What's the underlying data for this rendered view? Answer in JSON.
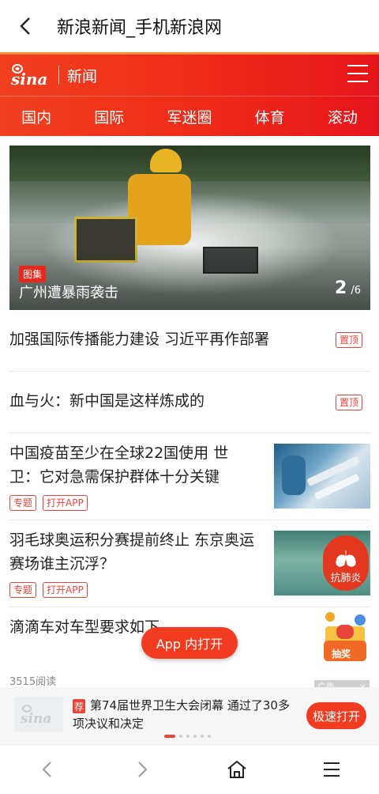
{
  "titlebar": {
    "title": "新浪新闻_手机新浪网"
  },
  "header": {
    "logo_text": "sina",
    "channel": "新闻",
    "nav": [
      "国内",
      "国际",
      "军迷圈",
      "体育",
      "滚动"
    ]
  },
  "hero": {
    "tag": "图集",
    "caption": "广州遭暴雨袭击",
    "current": "2",
    "total": "/6"
  },
  "news": [
    {
      "headline": "加强国际传播能力建设 习近平再作部署",
      "pin": "置顶"
    },
    {
      "headline": "血与火：新中国是这样炼成的",
      "pin": "置顶"
    },
    {
      "headline": "中国疫苗至少在全球22国使用 世卫：它对急需保护群体十分关键",
      "tags": [
        "专题",
        "打开APP"
      ]
    },
    {
      "headline": "羽毛球奥运积分赛提前终止 东京奥运赛场谁主沉浮？",
      "tags": [
        "专题",
        "打开APP"
      ],
      "thumb_badge": "抗肺炎"
    },
    {
      "headline": "滴滴车对车型要求如下",
      "reads": "3515阅读"
    }
  ],
  "floating": {
    "open_app": "App 内打开",
    "prize": "抽奖",
    "ad_label": "广告",
    "ad_close": "×"
  },
  "banner": {
    "logo_text": "sina",
    "rec": "荐",
    "text": "第74届世界卫生大会闭幕 通过了30多项决议和决定",
    "button": "极速打开"
  },
  "colors": {
    "brand": "#e6141a",
    "accent": "#f13c22"
  }
}
